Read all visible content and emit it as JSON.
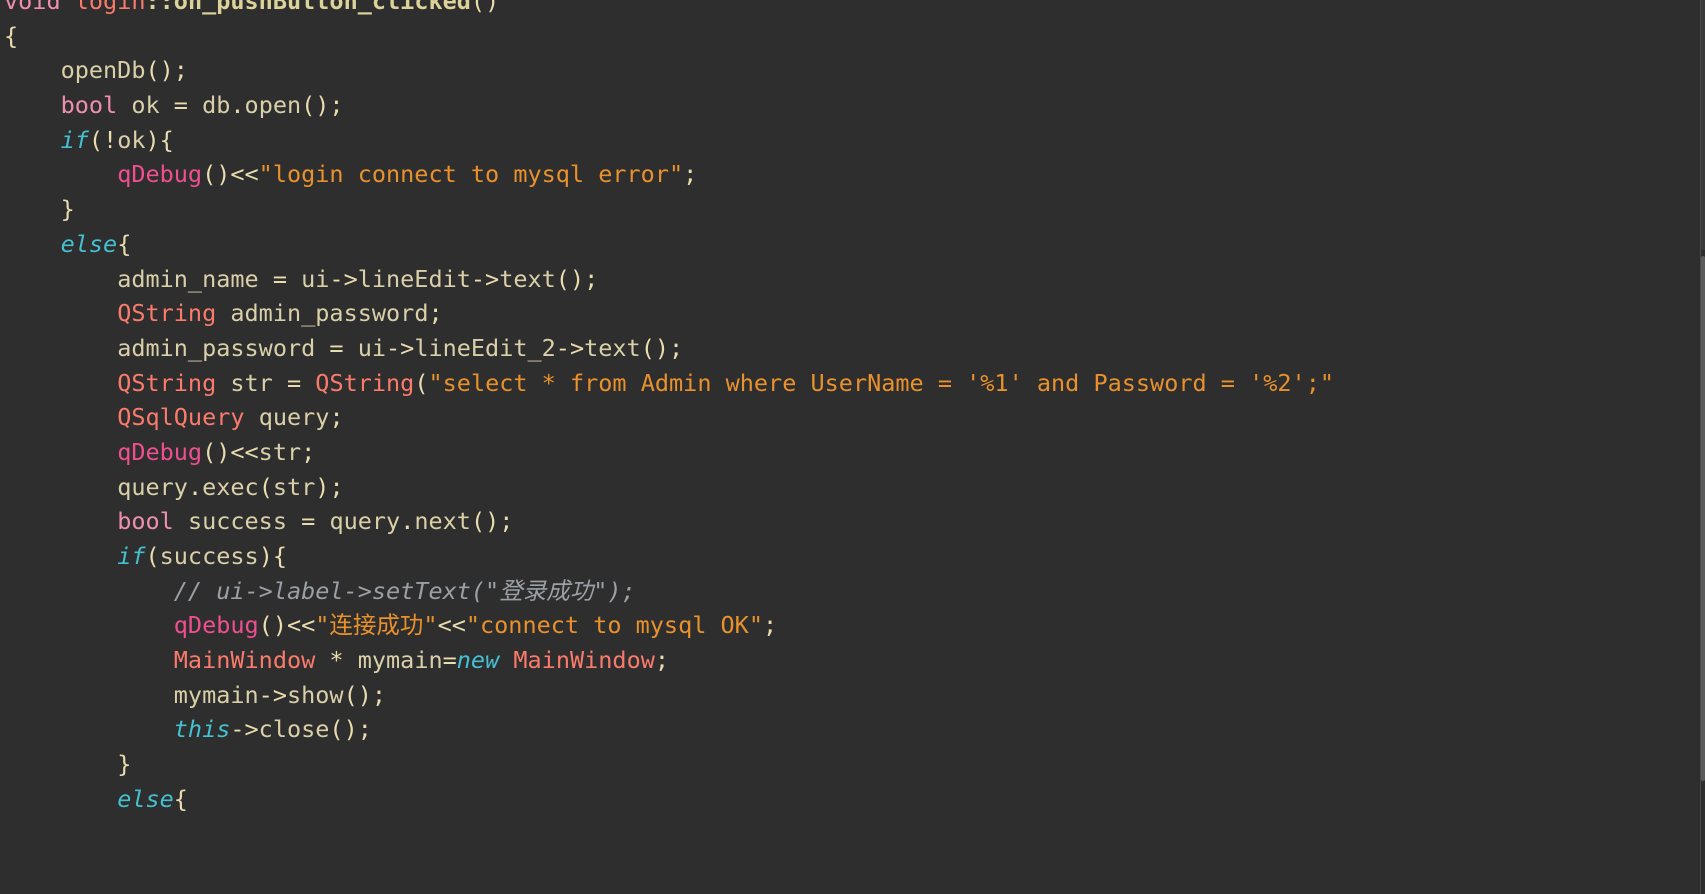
{
  "editor": {
    "language": "C++",
    "theme": "dark",
    "background_color": "#2e2e2e",
    "scrollbar": {
      "name": "vertical-scrollbar",
      "thumb_color": "#6b6b6b",
      "track_color": "#2e2e2e"
    },
    "colors": {
      "plain": "#d9cfa8",
      "type": "#fa7b6c",
      "keyword": "#ef8eb0",
      "control": "#44c0d0",
      "function": "#ef4f91",
      "function_definition": "#dcd39a",
      "string": "#e8912d",
      "comment": "#9aa0a6",
      "punctuation": "#e9dcae"
    }
  },
  "code": {
    "lines": [
      {
        "id": "line-signature",
        "tokens": [
          {
            "text": "void",
            "cls": "t-kw"
          },
          {
            "text": " ",
            "cls": "t-plain"
          },
          {
            "text": "login",
            "cls": "t-type"
          },
          {
            "text": "::on_pushButton_clicked",
            "cls": "t-fndef"
          },
          {
            "text": "()",
            "cls": "t-punct"
          }
        ]
      },
      {
        "id": "line-open-brace",
        "tokens": [
          {
            "text": "{",
            "cls": "t-punct"
          }
        ]
      },
      {
        "id": "line-opendb",
        "tokens": [
          {
            "text": "    ",
            "cls": "t-plain"
          },
          {
            "text": "openDb",
            "cls": "t-ident"
          },
          {
            "text": "();",
            "cls": "t-punct"
          }
        ]
      },
      {
        "id": "line-bool-ok",
        "tokens": [
          {
            "text": "    ",
            "cls": "t-plain"
          },
          {
            "text": "bool",
            "cls": "t-kw"
          },
          {
            "text": " ",
            "cls": "t-plain"
          },
          {
            "text": "ok",
            "cls": "t-ident"
          },
          {
            "text": " = ",
            "cls": "t-op"
          },
          {
            "text": "db",
            "cls": "t-ident"
          },
          {
            "text": ".",
            "cls": "t-punct"
          },
          {
            "text": "open",
            "cls": "t-ident"
          },
          {
            "text": "();",
            "cls": "t-punct"
          }
        ]
      },
      {
        "id": "line-if-not-ok",
        "tokens": [
          {
            "text": "    ",
            "cls": "t-plain"
          },
          {
            "text": "if",
            "cls": "t-ctrl"
          },
          {
            "text": "(!",
            "cls": "t-punct"
          },
          {
            "text": "ok",
            "cls": "t-ident"
          },
          {
            "text": "){",
            "cls": "t-punct"
          }
        ]
      },
      {
        "id": "line-qdebug-error",
        "tokens": [
          {
            "text": "        ",
            "cls": "t-plain"
          },
          {
            "text": "qDebug",
            "cls": "t-func"
          },
          {
            "text": "()<<",
            "cls": "t-punct"
          },
          {
            "text": "\"login connect to mysql error\"",
            "cls": "t-str"
          },
          {
            "text": ";",
            "cls": "t-punct"
          }
        ]
      },
      {
        "id": "line-close-brace-1",
        "tokens": [
          {
            "text": "    ",
            "cls": "t-plain"
          },
          {
            "text": "}",
            "cls": "t-punct"
          }
        ]
      },
      {
        "id": "line-else-1",
        "tokens": [
          {
            "text": "    ",
            "cls": "t-plain"
          },
          {
            "text": "else",
            "cls": "t-ctrl"
          },
          {
            "text": "{",
            "cls": "t-punct"
          }
        ]
      },
      {
        "id": "line-admin-name",
        "tokens": [
          {
            "text": "        ",
            "cls": "t-plain"
          },
          {
            "text": "admin_name",
            "cls": "t-ident"
          },
          {
            "text": " = ",
            "cls": "t-op"
          },
          {
            "text": "ui",
            "cls": "t-ident"
          },
          {
            "text": "->",
            "cls": "t-punct"
          },
          {
            "text": "lineEdit",
            "cls": "t-ident"
          },
          {
            "text": "->",
            "cls": "t-punct"
          },
          {
            "text": "text",
            "cls": "t-ident"
          },
          {
            "text": "();",
            "cls": "t-punct"
          }
        ]
      },
      {
        "id": "line-qstring-admin-password",
        "tokens": [
          {
            "text": "        ",
            "cls": "t-plain"
          },
          {
            "text": "QString",
            "cls": "t-type"
          },
          {
            "text": " ",
            "cls": "t-plain"
          },
          {
            "text": "admin_password",
            "cls": "t-ident"
          },
          {
            "text": ";",
            "cls": "t-punct"
          }
        ]
      },
      {
        "id": "line-admin-password-assign",
        "tokens": [
          {
            "text": "        ",
            "cls": "t-plain"
          },
          {
            "text": "admin_password",
            "cls": "t-ident"
          },
          {
            "text": " = ",
            "cls": "t-op"
          },
          {
            "text": "ui",
            "cls": "t-ident"
          },
          {
            "text": "->",
            "cls": "t-punct"
          },
          {
            "text": "lineEdit_2",
            "cls": "t-ident"
          },
          {
            "text": "->",
            "cls": "t-punct"
          },
          {
            "text": "text",
            "cls": "t-ident"
          },
          {
            "text": "();",
            "cls": "t-punct"
          }
        ]
      },
      {
        "id": "line-sql-string",
        "tokens": [
          {
            "text": "        ",
            "cls": "t-plain"
          },
          {
            "text": "QString",
            "cls": "t-type"
          },
          {
            "text": " ",
            "cls": "t-plain"
          },
          {
            "text": "str",
            "cls": "t-ident"
          },
          {
            "text": " = ",
            "cls": "t-op"
          },
          {
            "text": "QString",
            "cls": "t-type"
          },
          {
            "text": "(",
            "cls": "t-punct"
          },
          {
            "text": "\"select * from Admin where UserName = '%1' and Password = '%2';\"",
            "cls": "t-str"
          }
        ]
      },
      {
        "id": "line-qsqlquery",
        "tokens": [
          {
            "text": "        ",
            "cls": "t-plain"
          },
          {
            "text": "QSqlQuery",
            "cls": "t-type"
          },
          {
            "text": " ",
            "cls": "t-plain"
          },
          {
            "text": "query",
            "cls": "t-ident"
          },
          {
            "text": ";",
            "cls": "t-punct"
          }
        ]
      },
      {
        "id": "line-qdebug-str",
        "tokens": [
          {
            "text": "        ",
            "cls": "t-plain"
          },
          {
            "text": "qDebug",
            "cls": "t-func"
          },
          {
            "text": "()<<",
            "cls": "t-punct"
          },
          {
            "text": "str",
            "cls": "t-ident"
          },
          {
            "text": ";",
            "cls": "t-punct"
          }
        ]
      },
      {
        "id": "line-query-exec",
        "tokens": [
          {
            "text": "        ",
            "cls": "t-plain"
          },
          {
            "text": "query",
            "cls": "t-ident"
          },
          {
            "text": ".",
            "cls": "t-punct"
          },
          {
            "text": "exec",
            "cls": "t-ident"
          },
          {
            "text": "(",
            "cls": "t-punct"
          },
          {
            "text": "str",
            "cls": "t-ident"
          },
          {
            "text": ");",
            "cls": "t-punct"
          }
        ]
      },
      {
        "id": "line-bool-success",
        "tokens": [
          {
            "text": "        ",
            "cls": "t-plain"
          },
          {
            "text": "bool",
            "cls": "t-kw"
          },
          {
            "text": " ",
            "cls": "t-plain"
          },
          {
            "text": "success",
            "cls": "t-ident"
          },
          {
            "text": " = ",
            "cls": "t-op"
          },
          {
            "text": "query",
            "cls": "t-ident"
          },
          {
            "text": ".",
            "cls": "t-punct"
          },
          {
            "text": "next",
            "cls": "t-ident"
          },
          {
            "text": "();",
            "cls": "t-punct"
          }
        ]
      },
      {
        "id": "line-if-success",
        "tokens": [
          {
            "text": "        ",
            "cls": "t-plain"
          },
          {
            "text": "if",
            "cls": "t-ctrl"
          },
          {
            "text": "(",
            "cls": "t-punct"
          },
          {
            "text": "success",
            "cls": "t-ident"
          },
          {
            "text": "){",
            "cls": "t-punct"
          }
        ]
      },
      {
        "id": "line-comment-settext",
        "tokens": [
          {
            "text": "            ",
            "cls": "t-plain"
          },
          {
            "text": "// ui->label->setText(\"登录成功\");",
            "cls": "t-comment"
          }
        ]
      },
      {
        "id": "line-qdebug-success",
        "tokens": [
          {
            "text": "            ",
            "cls": "t-plain"
          },
          {
            "text": "qDebug",
            "cls": "t-func"
          },
          {
            "text": "()<<",
            "cls": "t-punct"
          },
          {
            "text": "\"连接成功\"",
            "cls": "t-str"
          },
          {
            "text": "<<",
            "cls": "t-punct"
          },
          {
            "text": "\"connect to mysql OK\"",
            "cls": "t-str"
          },
          {
            "text": ";",
            "cls": "t-punct"
          }
        ]
      },
      {
        "id": "line-mainwindow-new",
        "tokens": [
          {
            "text": "            ",
            "cls": "t-plain"
          },
          {
            "text": "MainWindow",
            "cls": "t-type"
          },
          {
            "text": " ",
            "cls": "t-plain"
          },
          {
            "text": "*",
            "cls": "t-punct"
          },
          {
            "text": " ",
            "cls": "t-plain"
          },
          {
            "text": "mymain",
            "cls": "t-ident"
          },
          {
            "text": "=",
            "cls": "t-op"
          },
          {
            "text": "new",
            "cls": "t-ctrl"
          },
          {
            "text": " ",
            "cls": "t-plain"
          },
          {
            "text": "MainWindow",
            "cls": "t-type"
          },
          {
            "text": ";",
            "cls": "t-punct"
          }
        ]
      },
      {
        "id": "line-mymain-show",
        "tokens": [
          {
            "text": "            ",
            "cls": "t-plain"
          },
          {
            "text": "mymain",
            "cls": "t-ident"
          },
          {
            "text": "->",
            "cls": "t-punct"
          },
          {
            "text": "show",
            "cls": "t-ident"
          },
          {
            "text": "();",
            "cls": "t-punct"
          }
        ]
      },
      {
        "id": "line-this-close",
        "tokens": [
          {
            "text": "            ",
            "cls": "t-plain"
          },
          {
            "text": "this",
            "cls": "t-ctrl"
          },
          {
            "text": "->",
            "cls": "t-punct"
          },
          {
            "text": "close",
            "cls": "t-ident"
          },
          {
            "text": "();",
            "cls": "t-punct"
          }
        ]
      },
      {
        "id": "line-close-brace-2",
        "tokens": [
          {
            "text": "        ",
            "cls": "t-plain"
          },
          {
            "text": "}",
            "cls": "t-punct"
          }
        ]
      },
      {
        "id": "line-else-2",
        "tokens": [
          {
            "text": "        ",
            "cls": "t-plain"
          },
          {
            "text": "else",
            "cls": "t-ctrl"
          },
          {
            "text": "{",
            "cls": "t-punct"
          }
        ]
      }
    ]
  }
}
